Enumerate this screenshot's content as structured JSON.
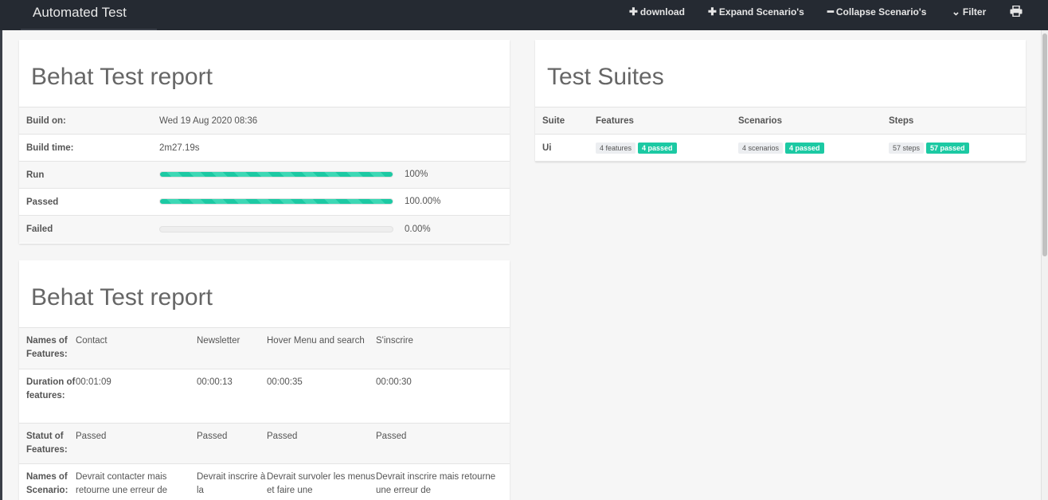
{
  "nav": {
    "brand": "Automated Test",
    "download": "download",
    "expand": "Expand Scenario's",
    "collapse": "Collapse Scenario's",
    "filter": "Filter"
  },
  "report": {
    "title": "Behat Test report",
    "rows": {
      "build_on": {
        "label": "Build on:",
        "value": "Wed 19 Aug 2020 08:36"
      },
      "build_time": {
        "label": "Build time:",
        "value": "2m27.19s"
      },
      "run": {
        "label": "Run",
        "value": "100%",
        "progress": 1.0
      },
      "passed": {
        "label": "Passed",
        "value": "100.00%",
        "progress": 1.0
      },
      "failed": {
        "label": "Failed",
        "value": "0.00%",
        "progress": 0.0
      }
    }
  },
  "suites": {
    "title": "Test Suites",
    "headers": {
      "suite": "Suite",
      "features": "Features",
      "scenarios": "Scenarios",
      "steps": "Steps"
    },
    "row": {
      "suite": "Ui",
      "features_total": "4 features",
      "features_passed": "4 passed",
      "scenarios_total": "4 scenarios",
      "scenarios_passed": "4 passed",
      "steps_total": "57 steps",
      "steps_passed": "57 passed"
    }
  },
  "features": {
    "title": "Behat Test report",
    "names_label": "Names of Features:",
    "duration_label": "Duration of features:",
    "status_label": "Statut of Features:",
    "scenario_label": "Names of Scenario:",
    "names": [
      "Contact",
      "Newsletter",
      "Hover Menu and search",
      "S'inscrire"
    ],
    "durations": [
      "00:01:09",
      "00:00:13",
      "00:00:35",
      "00:00:30"
    ],
    "statuses": [
      "Passed",
      "Passed",
      "Passed",
      "Passed"
    ],
    "scenarios": [
      "Devrait contacter mais retourne une erreur de",
      "Devrait inscrire à la",
      "Devrait survoler les menus et faire une",
      "Devrait inscrire mais retourne une erreur de"
    ]
  },
  "colors": {
    "accent": "#1cc9a3",
    "navbar": "#252a32"
  },
  "icons": {
    "download": "plus-icon",
    "expand": "plus-icon",
    "collapse": "minus-icon",
    "filter": "chevron-down-icon",
    "print": "printer-icon"
  }
}
